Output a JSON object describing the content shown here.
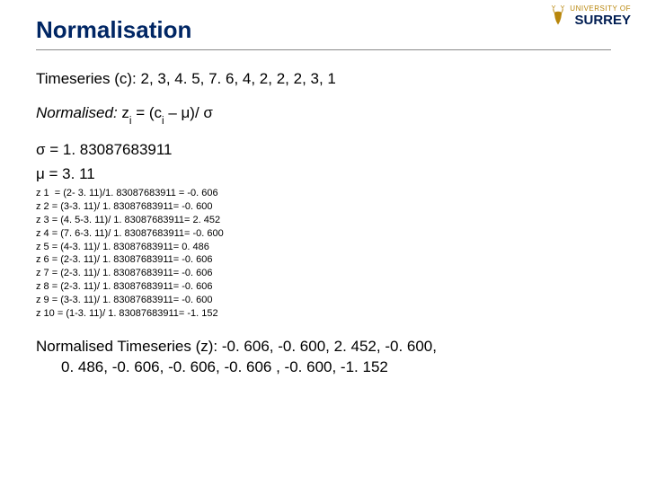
{
  "title": "Normalisation",
  "timeseries_label": "Timeseries (c): ",
  "timeseries_values": "2, 3, 4. 5, 7. 6, 4, 2, 2, 2, 3, 1",
  "normalised_label": "Normalised: ",
  "normalised_formula_left": "z",
  "normalised_formula_sub": "i",
  "normalised_formula_mid": " =  (c",
  "normalised_formula_sub2": "i",
  "normalised_formula_right": " – μ)/ σ",
  "sigma_line": "σ = 1. 83087683911",
  "mu_line": "μ = 3. 11",
  "calcs": [
    "z 1  = (2- 3. 11)/1. 83087683911 = -0. 606",
    "z 2 = (3-3. 11)/ 1. 83087683911= -0. 600",
    "z 3 = (4. 5-3. 11)/ 1. 83087683911= 2. 452",
    "z 4 = (7. 6-3. 11)/ 1. 83087683911= -0. 600",
    "z 5 = (4-3. 11)/ 1. 83087683911= 0. 486",
    "z 6 = (2-3. 11)/ 1. 83087683911= -0. 606",
    "z 7 = (2-3. 11)/ 1. 83087683911= -0. 606",
    "z 8 = (2-3. 11)/ 1. 83087683911= -0. 606",
    "z 9 = (3-3. 11)/ 1. 83087683911= -0. 600",
    "z 10 = (1-3. 11)/ 1. 83087683911= -1. 152"
  ],
  "result_label": "Normalised Timeseries (z): ",
  "result_line1": "-0. 606, -0. 600, 2. 452, -0. 600,",
  "result_line2": "0. 486, -0. 606, -0. 606, -0. 606 , -0. 600, -1. 152",
  "logo": {
    "uni": "UNIVERSITY OF",
    "name": "SURREY"
  }
}
